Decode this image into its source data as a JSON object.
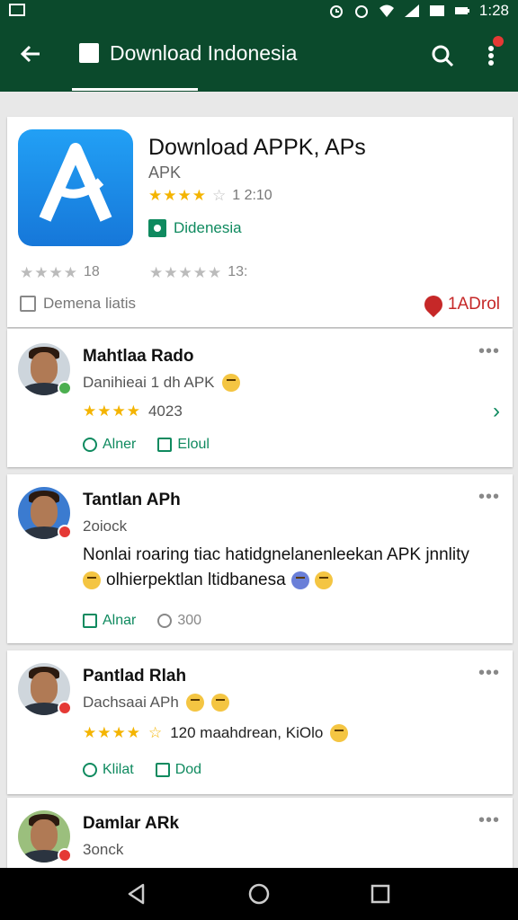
{
  "status_bar": {
    "time": "1:28"
  },
  "app_bar": {
    "title": "Download Indonesia"
  },
  "app": {
    "title": "Download APPK, APs",
    "subtitle": "APK",
    "rating_stars": "★★★★",
    "rating_half": "☆",
    "rating_text": "1 2:10",
    "developer": "Didenesia",
    "stat1_stars": "★★★★",
    "stat1_value": "18",
    "stat2_stars": "★★★★★",
    "stat2_value": "13:",
    "genre": "Demena liatis",
    "brand": "1ADrol"
  },
  "reviews": [
    {
      "name": "Mahtlaa Rado",
      "line1": "Danihieai 1 dh APK",
      "stars": "★★★★",
      "count": "4023",
      "action1": "Alner",
      "action2": "Eloul",
      "badge_color": "#4caf50"
    },
    {
      "name": "Tantlan APh",
      "sub": "2oiock",
      "text_line1": "Nonlai roaring tiac hatidgnelanenleekan APK jnnlity",
      "text_line2": "olhierpektlan ltidbanesa",
      "action1": "Alnar",
      "action2": "300",
      "badge_color": "#e53935"
    },
    {
      "name": "Pantlad Rlah",
      "sub": "Dachsaai APh",
      "stars": "★★★★",
      "star_half": "☆",
      "line2": "120 maahdrean, KiOlo",
      "action1": "Klilat",
      "action2": "Dod",
      "badge_color": "#e53935"
    },
    {
      "name": "Damlar ARk",
      "sub": "3onck",
      "badge_color": "#e53935"
    }
  ]
}
